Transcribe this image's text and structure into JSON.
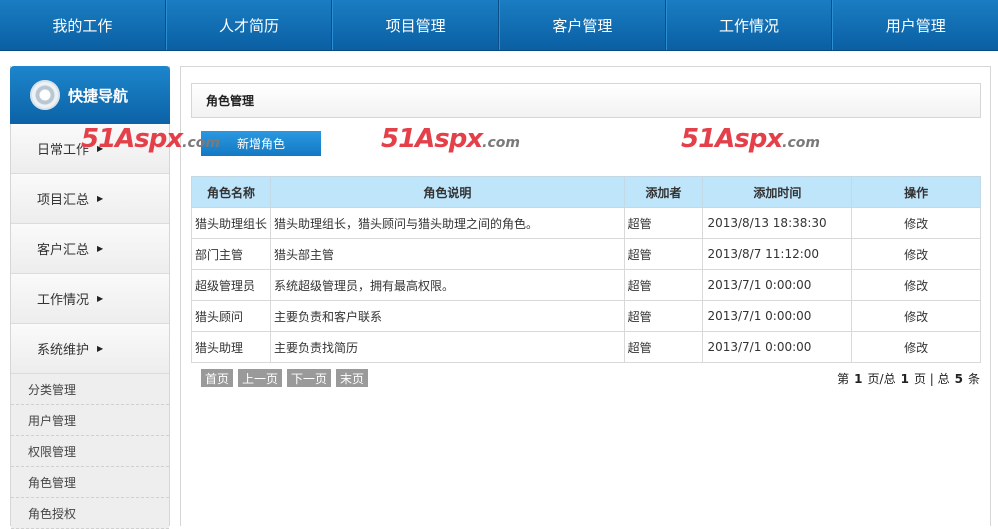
{
  "topnav": [
    "我的工作",
    "人才简历",
    "项目管理",
    "客户管理",
    "工作情况",
    "用户管理"
  ],
  "sidebar": {
    "title": "快捷导航",
    "items": [
      "日常工作",
      "项目汇总",
      "客户汇总",
      "工作情况",
      "系统维护"
    ],
    "subitems": [
      "分类管理",
      "用户管理",
      "权限管理",
      "角色管理",
      "角色授权"
    ]
  },
  "main": {
    "title": "角色管理",
    "add_button": "新增角色",
    "watermark": {
      "brand": "51Aspx",
      "suffix": ".com"
    },
    "table": {
      "headers": [
        "角色名称",
        "角色说明",
        "添加者",
        "添加时间",
        "操作"
      ],
      "rows": [
        [
          "猎头助理组长",
          "猎头助理组长，猎头顾问与猎头助理之间的角色。",
          "超管",
          "2013/8/13 18:38:30",
          "修改"
        ],
        [
          "部门主管",
          "猎头部主管",
          "超管",
          "2013/8/7 11:12:00",
          "修改"
        ],
        [
          "超级管理员",
          "系统超级管理员，拥有最高权限。",
          "超管",
          "2013/7/1 0:00:00",
          "修改"
        ],
        [
          "猎头顾问",
          "主要负责和客户联系",
          "超管",
          "2013/7/1 0:00:00",
          "修改"
        ],
        [
          "猎头助理",
          "主要负责找简历",
          "超管",
          "2013/7/1 0:00:00",
          "修改"
        ]
      ]
    },
    "pager": {
      "buttons": [
        "首页",
        "上一页",
        "下一页",
        "末页"
      ],
      "info": {
        "prefix": "第",
        "current": "1",
        "mid1": "页/总",
        "total_pages": "1",
        "mid2": "页 | 总",
        "total_records": "5",
        "suffix": "条"
      }
    }
  }
}
